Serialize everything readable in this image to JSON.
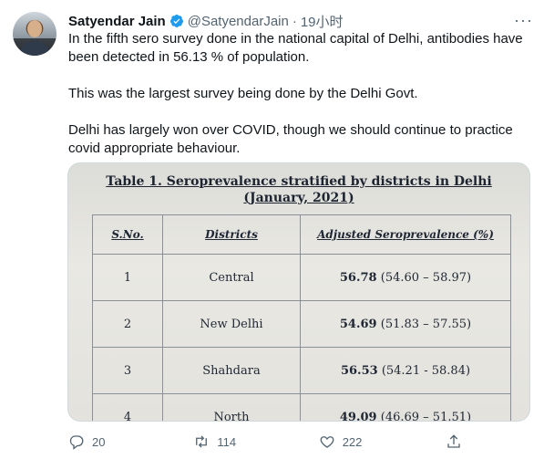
{
  "tweet": {
    "name": "Satyendar Jain",
    "handle": "@SatyendarJain",
    "dot": "·",
    "time": "19小时",
    "more": "···",
    "paragraphs": [
      "In the fifth sero survey done in the national capital of Delhi, antibodies have been detected in 56.13 % of population.",
      "This was the largest survey being done by the Delhi Govt.",
      "Delhi has largely won over COVID, though we should continue to practice covid appropriate behaviour."
    ]
  },
  "table_image": {
    "title": "Table 1.  Seroprevalence stratified by districts in Delhi",
    "subtitle": "(January, 2021)",
    "headers": [
      "S.No.",
      "Districts",
      "Adjusted Seroprevalence (%)"
    ],
    "rows": [
      {
        "sno": "1",
        "district": "Central",
        "value": "56.78",
        "ci": "(54.60 – 58.97)"
      },
      {
        "sno": "2",
        "district": "New Delhi",
        "value": "54.69",
        "ci": "(51.83 – 57.55)"
      },
      {
        "sno": "3",
        "district": "Shahdara",
        "value": "56.53",
        "ci": "(54.21 - 58.84)"
      },
      {
        "sno": "4",
        "district": "North",
        "value": "49.09",
        "ci": "(46.69 – 51.51)"
      }
    ]
  },
  "actions": {
    "reply_count": "20",
    "retweet_count": "114",
    "like_count": "222"
  },
  "icons": {
    "verified": "verified-badge-icon",
    "reply": "reply-icon",
    "retweet": "retweet-icon",
    "like": "heart-icon",
    "share": "share-icon",
    "more": "more-icon"
  },
  "colors": {
    "verified": "#1d9bf0",
    "muted": "#536471",
    "text": "#0f1419"
  }
}
